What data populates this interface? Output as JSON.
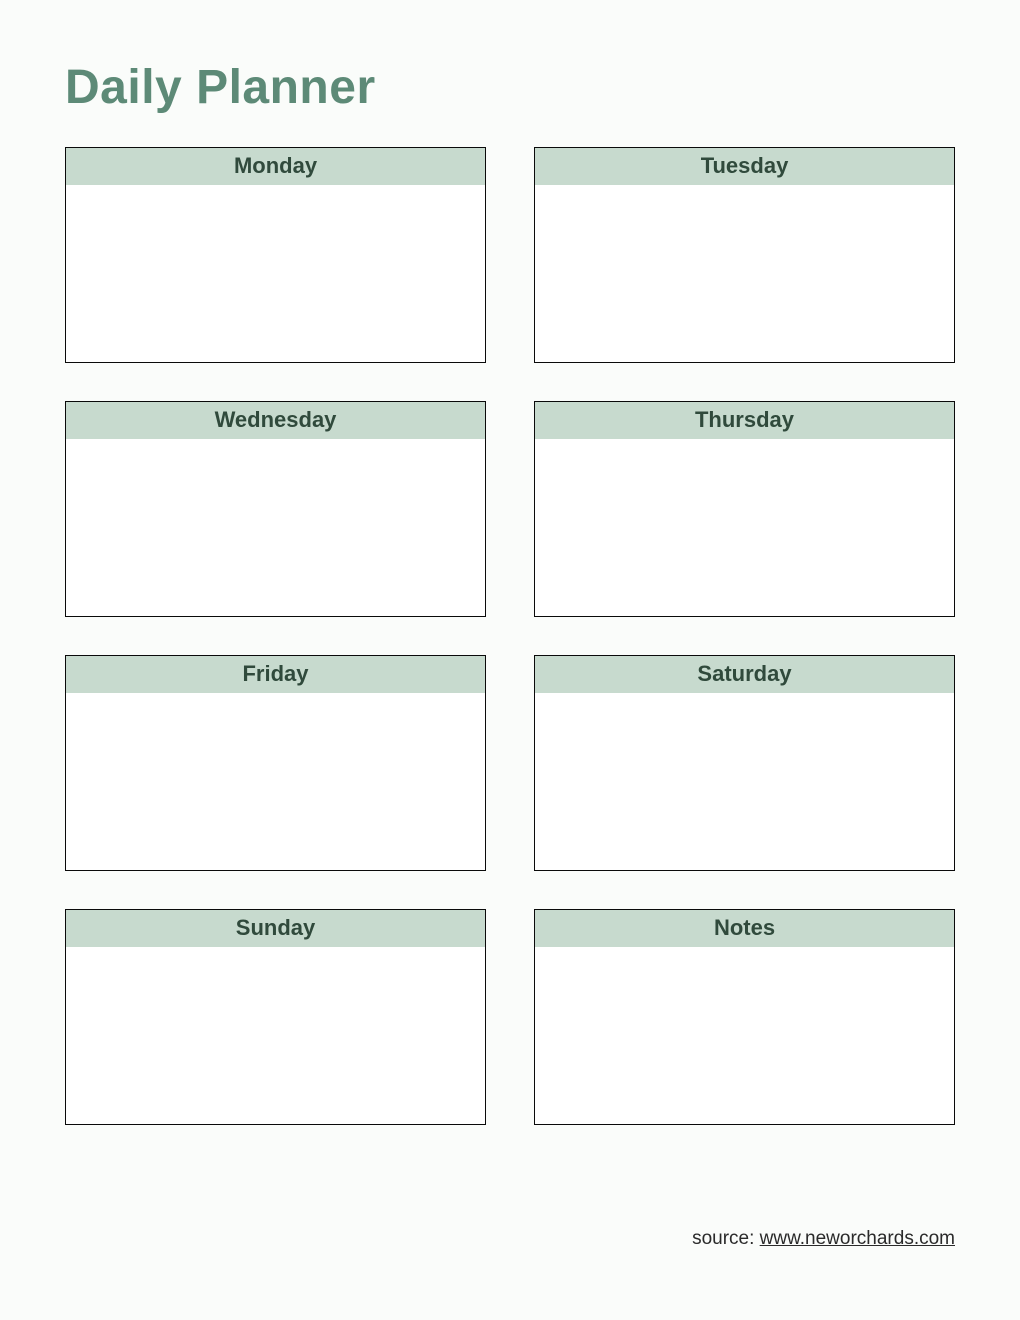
{
  "title": "Daily Planner",
  "cells": [
    {
      "label": "Monday"
    },
    {
      "label": "Tuesday"
    },
    {
      "label": "Wednesday"
    },
    {
      "label": "Thursday"
    },
    {
      "label": "Friday"
    },
    {
      "label": "Saturday"
    },
    {
      "label": "Sunday"
    },
    {
      "label": "Notes"
    }
  ],
  "footer": {
    "prefix": "source: ",
    "link_text": "www.neworchards.com"
  }
}
